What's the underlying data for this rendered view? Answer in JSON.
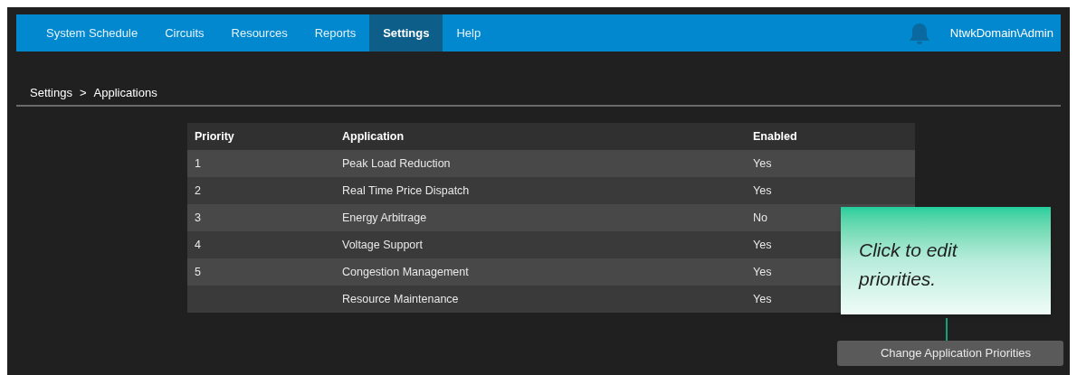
{
  "nav": {
    "tabs": [
      {
        "label": "System Schedule",
        "selected": false
      },
      {
        "label": "Circuits",
        "selected": false
      },
      {
        "label": "Resources",
        "selected": false
      },
      {
        "label": "Reports",
        "selected": false
      },
      {
        "label": "Settings",
        "selected": true
      },
      {
        "label": "Help",
        "selected": false
      }
    ],
    "user": "NtwkDomain\\Admin"
  },
  "breadcrumb": {
    "items": [
      "Settings",
      "Applications"
    ],
    "separator": ">"
  },
  "table": {
    "columns": [
      "Priority",
      "Application",
      "Enabled"
    ],
    "rows": [
      [
        "1",
        "Peak Load Reduction",
        "Yes"
      ],
      [
        "2",
        "Real Time Price Dispatch",
        "Yes"
      ],
      [
        "3",
        "Energy Arbitrage",
        "No"
      ],
      [
        "4",
        "Voltage Support",
        "Yes"
      ],
      [
        "5",
        "Congestion Management",
        "Yes"
      ],
      [
        "",
        "Resource Maintenance",
        "Yes"
      ]
    ]
  },
  "callout": {
    "text": "Click to edit priorities."
  },
  "button": {
    "label": "Change Application Priorities"
  }
}
